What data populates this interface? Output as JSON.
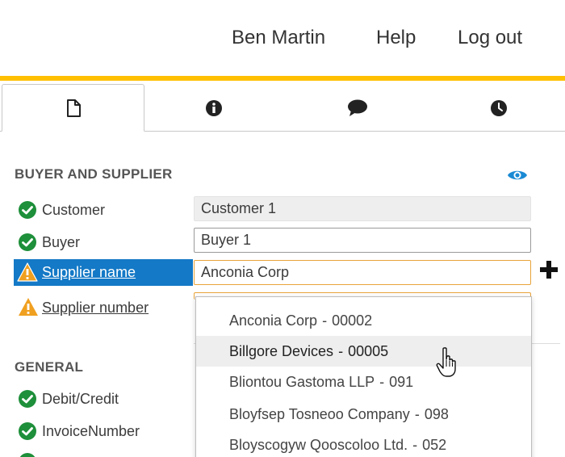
{
  "header": {
    "user_name": "Ben Martin",
    "help_label": "Help",
    "logout_label": "Log out",
    "accent_color": "#ffc000"
  },
  "tabs": [
    {
      "icon": "document-icon",
      "active": true
    },
    {
      "icon": "info-icon",
      "active": false
    },
    {
      "icon": "comment-icon",
      "active": false
    },
    {
      "icon": "clock-icon",
      "active": false
    }
  ],
  "buyer_supplier": {
    "title": "BUYER AND SUPPLIER",
    "view_icon": "eye-icon",
    "rows": [
      {
        "label": "Customer",
        "status": "ok",
        "value": "Customer 1"
      },
      {
        "label": "Buyer",
        "status": "ok",
        "value": "Buyer 1"
      },
      {
        "label": "Supplier name",
        "status": "warning",
        "value": "Anconia Corp"
      },
      {
        "label": "Supplier number",
        "status": "warning",
        "value": ""
      }
    ]
  },
  "general": {
    "title": "GENERAL",
    "rows": [
      {
        "label": "Debit/Credit",
        "status": "ok"
      },
      {
        "label": "InvoiceNumber",
        "status": "ok"
      }
    ]
  },
  "supplier_dropdown": {
    "options": [
      {
        "name": "Anconia Corp",
        "number": "00002"
      },
      {
        "name": "Billgore Devices",
        "number": "00005"
      },
      {
        "name": "Bliontou Gastoma LLP",
        "number": "091"
      },
      {
        "name": "Bloyfsep Tosneoo Company",
        "number": "098"
      },
      {
        "name": "Bloyscogyw Qooscoloo Ltd.",
        "number": "052"
      }
    ],
    "separator": "-",
    "hovered_index": 1
  },
  "colors": {
    "ok_green": "#1e8f3a",
    "warning_orange": "#f0a020",
    "selected_blue": "#1479c6",
    "eye_blue": "#1a8ad4"
  }
}
